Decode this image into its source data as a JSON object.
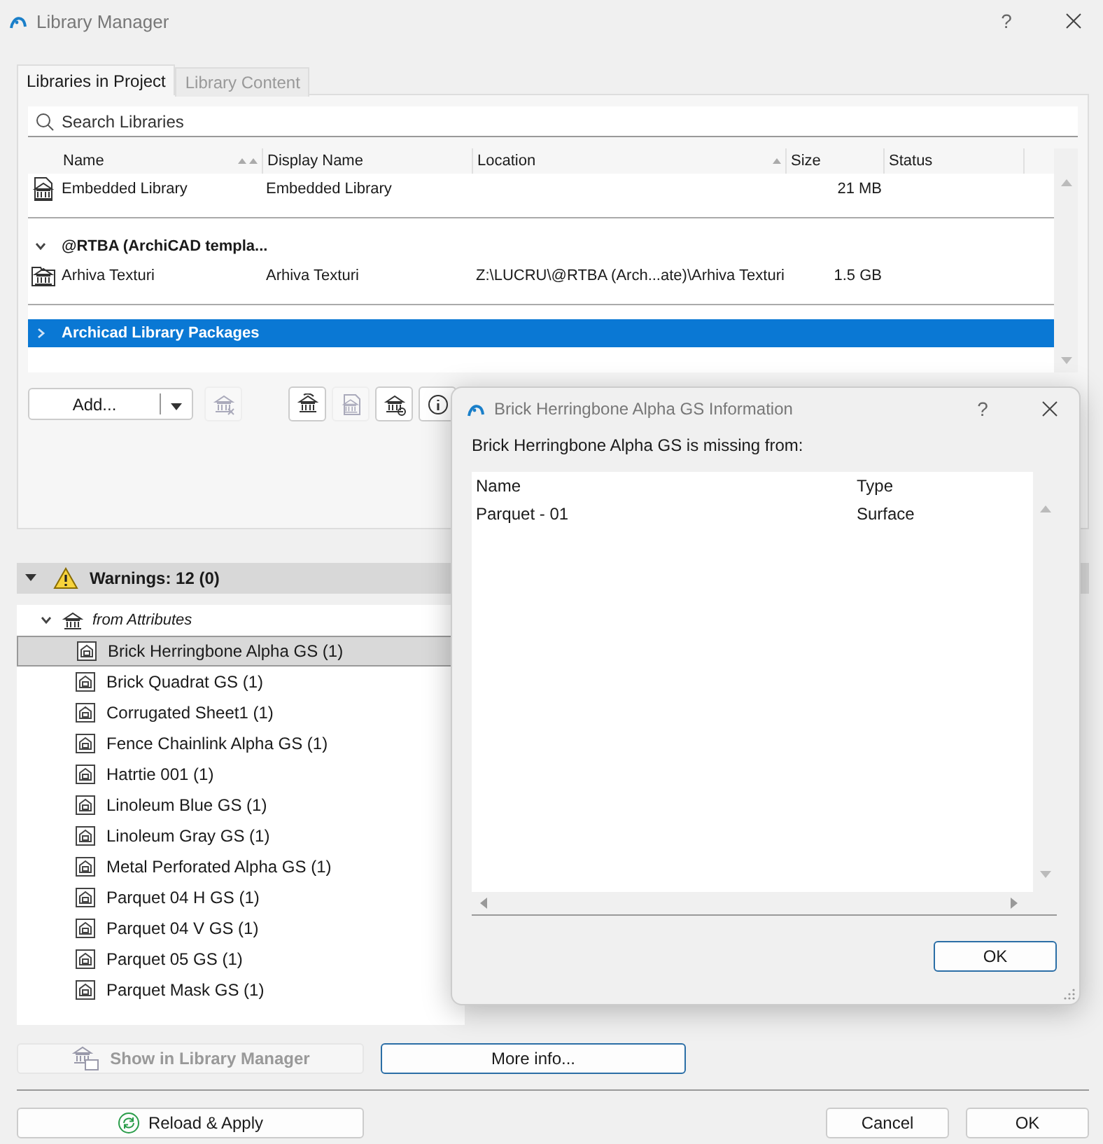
{
  "window": {
    "title": "Library Manager",
    "help": "?"
  },
  "tabs": [
    {
      "label": "Libraries in Project",
      "selected": true
    },
    {
      "label": "Library Content",
      "selected": false
    }
  ],
  "search": {
    "placeholder": "Search Libraries"
  },
  "libraries": {
    "columns": [
      "Name",
      "Display Name",
      "Location",
      "Size",
      "Status"
    ],
    "rows": [
      {
        "kind": "embedded",
        "name": "Embedded Library",
        "display_name": "Embedded Library",
        "size": "21 MB",
        "selected": false
      },
      {
        "kind": "group",
        "name": "@RTBA (ArchiCAD templa...",
        "expanded": true,
        "selected": false,
        "children": [
          {
            "kind": "linked",
            "name": "Arhiva Texturi",
            "display_name": "Arhiva Texturi",
            "location": "Z:\\LUCRU\\@RTBA (Arch...ate)\\Arhiva Texturi",
            "size": "1.5 GB",
            "selected": false
          }
        ]
      },
      {
        "kind": "group",
        "name": "Archicad Library Packages",
        "expanded": false,
        "selected": true
      }
    ]
  },
  "add_button": {
    "label": "Add..."
  },
  "library_tools": [
    {
      "disabled": true
    },
    {
      "disabled": false
    },
    {
      "disabled": true
    },
    {
      "disabled": false
    },
    {
      "disabled": false
    }
  ],
  "warnings": {
    "label": "Warnings: 12 (0)",
    "expanded": true,
    "groups": [
      {
        "label": "from Attributes",
        "expanded": true,
        "children": [
          {
            "label": "Brick Herringbone Alpha GS (1)",
            "selected": true
          },
          {
            "label": "Brick Quadrat GS (1)",
            "selected": false
          },
          {
            "label": "Corrugated Sheet1 (1)",
            "selected": false
          },
          {
            "label": "Fence Chainlink Alpha GS (1)",
            "selected": false
          },
          {
            "label": "Hatrtie 001 (1)",
            "selected": false
          },
          {
            "label": "Linoleum Blue GS (1)",
            "selected": false
          },
          {
            "label": "Linoleum Gray GS (1)",
            "selected": false
          },
          {
            "label": "Metal Perforated Alpha GS (1)",
            "selected": false
          },
          {
            "label": "Parquet 04 H GS (1)",
            "selected": false
          },
          {
            "label": "Parquet 04 V GS (1)",
            "selected": false
          },
          {
            "label": "Parquet 05 GS (1)",
            "selected": false
          },
          {
            "label": "Parquet Mask GS (1)",
            "selected": false
          }
        ]
      }
    ]
  },
  "show_button": {
    "label": "Show in Library Manager",
    "disabled": true
  },
  "more_info_button": {
    "label": "More info...",
    "focused": true
  },
  "reload_button": {
    "label": "Reload & Apply"
  },
  "cancel_button": {
    "label": "Cancel"
  },
  "ok_button": {
    "label": "OK"
  },
  "dialog": {
    "title": "Brick Herringbone Alpha GS Information",
    "help": "?",
    "message": "Brick Herringbone Alpha GS is missing from:",
    "columns": [
      "Name",
      "Type"
    ],
    "rows": [
      {
        "name": "Parquet - 01",
        "type": "Surface"
      }
    ],
    "ok_button": {
      "label": "OK",
      "focused": true
    }
  }
}
